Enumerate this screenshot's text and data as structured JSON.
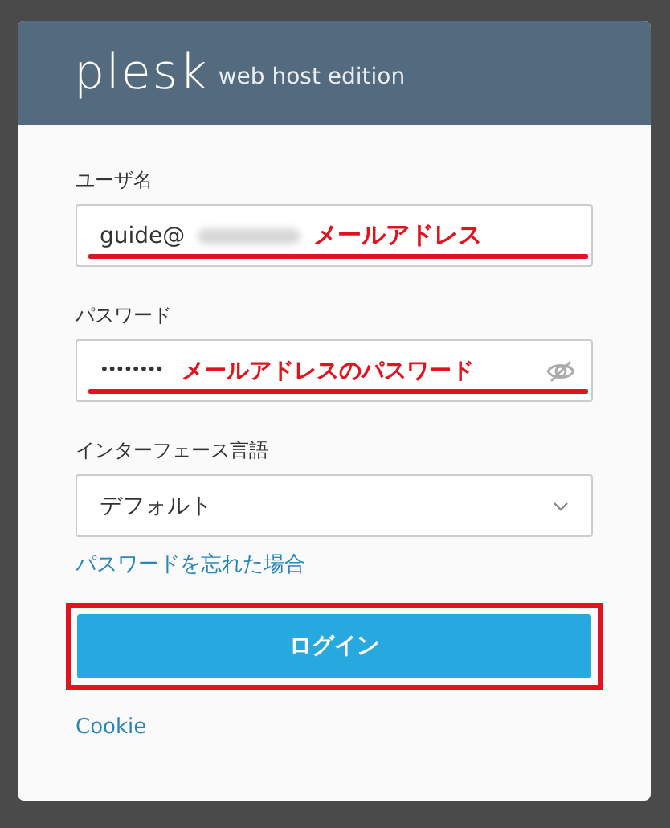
{
  "header": {
    "logo": "plesk",
    "subtitle": "web host edition"
  },
  "username": {
    "label": "ユーザ名",
    "value": "guide@",
    "redacted": true,
    "annotation": "メールアドレス"
  },
  "password": {
    "label": "パスワード",
    "value": "••••••••",
    "annotation": "メールアドレスのパスワード"
  },
  "language": {
    "label": "インターフェース言語",
    "value": "デフォルト"
  },
  "forgot_link": "パスワードを忘れた場合",
  "login_button": {
    "label": "ログイン",
    "highlighted": true
  },
  "cookie_link": "Cookie"
}
